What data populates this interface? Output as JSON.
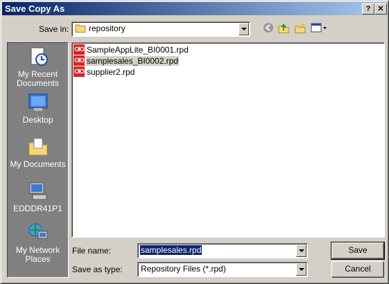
{
  "window": {
    "title": "Save Copy As",
    "help_label": "?",
    "close_label": "✕"
  },
  "save_in": {
    "label": "Save in:",
    "value": "repository",
    "toolbar_icons": [
      "back-icon",
      "up-folder-icon",
      "new-folder-icon",
      "view-menu-icon"
    ]
  },
  "places": [
    {
      "label": "My Recent Documents",
      "icon": "recent-documents-icon"
    },
    {
      "label": "Desktop",
      "icon": "desktop-icon"
    },
    {
      "label": "My Documents",
      "icon": "my-documents-icon"
    },
    {
      "label": "EDDDR41P1",
      "icon": "my-computer-icon"
    },
    {
      "label": "My Network Places",
      "icon": "network-places-icon"
    }
  ],
  "files": [
    {
      "name": "SampleAppLite_BI0001.rpd",
      "icon": "rpd-file-icon",
      "selected": false
    },
    {
      "name": "samplesales_BI0002.rpd",
      "icon": "rpd-file-icon",
      "selected": true
    },
    {
      "name": "supplier2.rpd",
      "icon": "rpd-file-icon",
      "selected": false
    }
  ],
  "file_name": {
    "label": "File name:",
    "value": "samplesales.rpd"
  },
  "save_as_type": {
    "label": "Save as type:",
    "value": "Repository Files (*.rpd)"
  },
  "buttons": {
    "save": "Save",
    "cancel": "Cancel"
  },
  "colors": {
    "title_bar_start": "#0a246a",
    "title_bar_end": "#a6caf0",
    "dialog_face": "#d4d0c8",
    "places_bar": "#808080",
    "selection": "#0a246a",
    "rpd_icon": "#e02020"
  }
}
